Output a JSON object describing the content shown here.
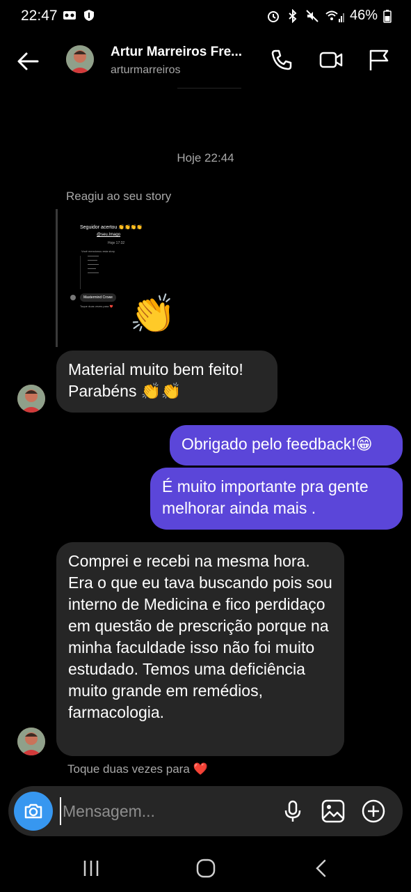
{
  "status": {
    "time": "22:47",
    "battery": "46%"
  },
  "header": {
    "name": "Artur Marreiros Fre...",
    "username": "arturmarreiros"
  },
  "chat": {
    "timestamp": "Hoje 22:44",
    "story_reply_label": "Reagiu ao seu story",
    "story_preview": {
      "line1": "Seguidor acertou 👏👏👏👏",
      "line2": "@seu.Imago",
      "line3": "Hoje 17:32",
      "line4": "Você mencionou esta story",
      "badge": "Mastermind Crowe",
      "line5": "Toque duas vezes para ❤️"
    },
    "reaction": "👏",
    "messages": [
      {
        "from": "them",
        "text": "Material muito bem feito! Parabéns 👏👏"
      },
      {
        "from": "me",
        "text": "Obrigado pelo feedback!😁"
      },
      {
        "from": "me",
        "text": "É muito importante pra gente melhorar ainda mais ."
      },
      {
        "from": "them",
        "text": "Comprei e recebi na mesma hora. Era o que eu tava buscando pois sou interno de Medicina e fico perdidaço em questão de prescrição porque na minha faculdade isso não foi muito estudado. Temos uma deficiência muito grande em remédios, farmacologia."
      }
    ],
    "double_tap_hint": "Toque duas vezes para ❤️"
  },
  "composer": {
    "placeholder": "Mensagem..."
  },
  "colors": {
    "background": "#000000",
    "incoming_bubble": "#262626",
    "outgoing_bubble": "#5b46d9",
    "camera_button": "#3797f0",
    "secondary_text": "#a8a8a8"
  },
  "icons": [
    "back-arrow-icon",
    "phone-icon",
    "video-camera-icon",
    "flag-icon",
    "camera-icon",
    "microphone-icon",
    "gallery-icon",
    "add-circle-icon",
    "recents-icon",
    "home-icon",
    "nav-back-icon"
  ]
}
